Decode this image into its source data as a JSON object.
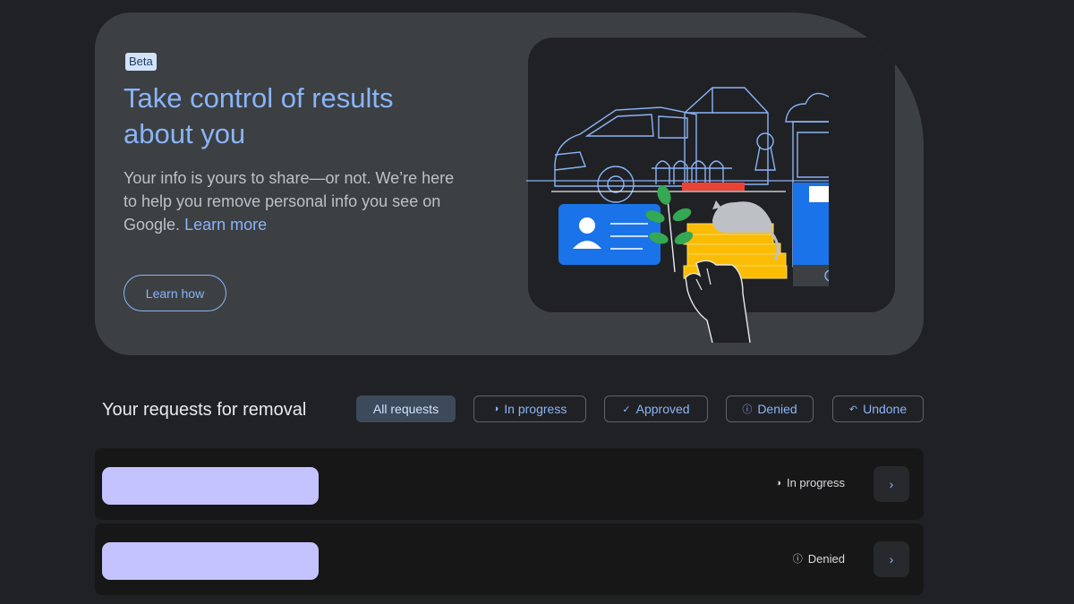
{
  "hero": {
    "badge": "Beta",
    "title": "Take control of results about you",
    "description": "Your info is yours to share—or not. We’re here to help you remove personal info you see on Google.",
    "learn_more": "Learn more",
    "learn_how": "Learn how"
  },
  "requests": {
    "title": "Your requests for removal",
    "filters": [
      {
        "label": "All requests",
        "icon": "",
        "selected": true
      },
      {
        "label": "In progress",
        "icon": "in-progress-icon",
        "selected": false
      },
      {
        "label": "Approved",
        "icon": "check-icon",
        "selected": false
      },
      {
        "label": "Denied",
        "icon": "denied-icon",
        "selected": false
      },
      {
        "label": "Undone",
        "icon": "undo-icon",
        "selected": false
      }
    ],
    "rows": [
      {
        "status": "In progress",
        "status_icon": "in-progress-icon"
      },
      {
        "status": "Denied",
        "status_icon": "denied-icon"
      }
    ]
  },
  "colors": {
    "accent": "#8ab4f8",
    "background": "#202124",
    "card": "#3c4043",
    "redaction": "#c5c3ff"
  }
}
